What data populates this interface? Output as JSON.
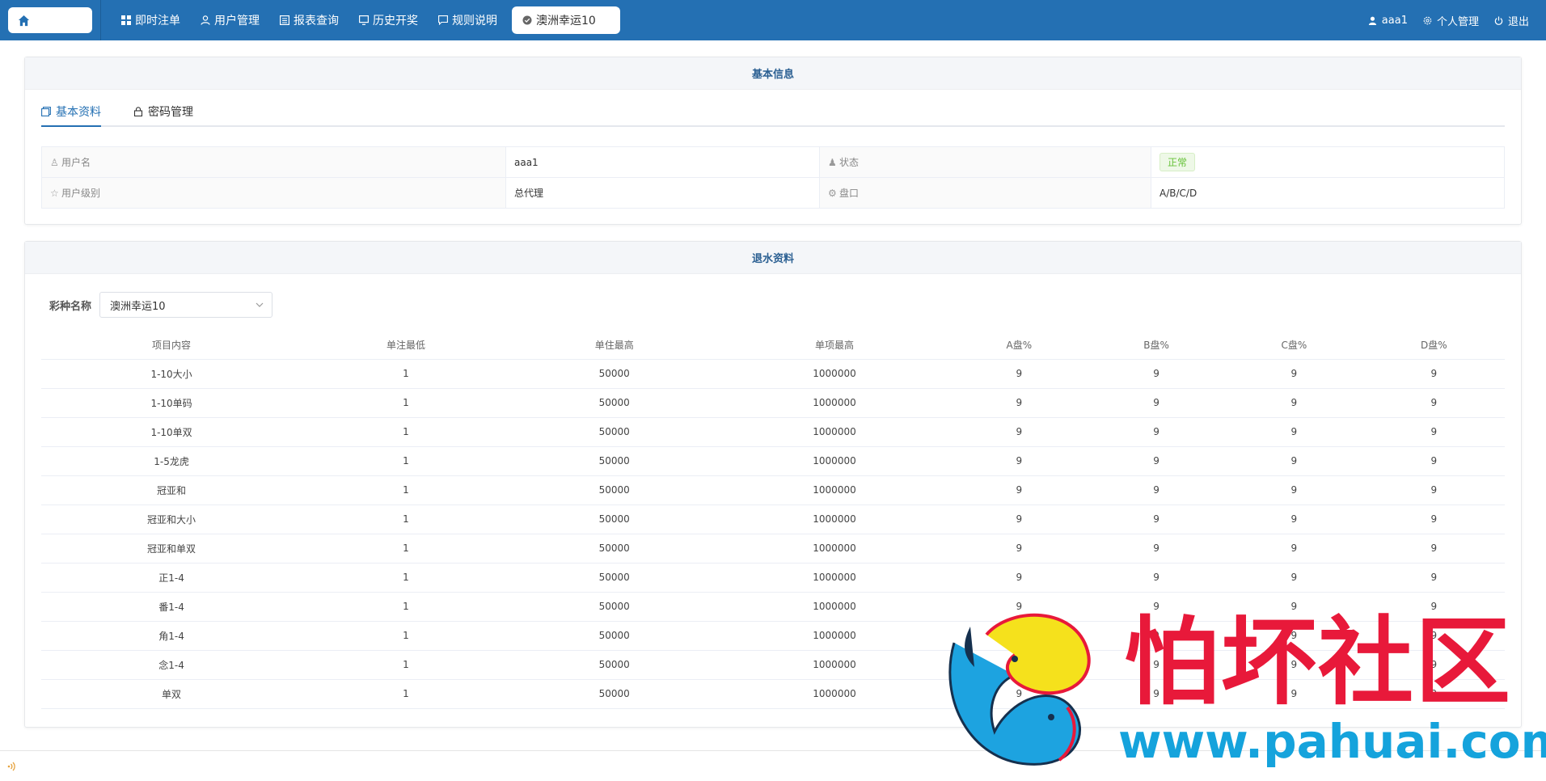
{
  "nav": {
    "items": [
      {
        "label": "即时注单",
        "icon": "grid-icon"
      },
      {
        "label": "用户管理",
        "icon": "user-icon"
      },
      {
        "label": "报表查询",
        "icon": "report-icon"
      },
      {
        "label": "历史开奖",
        "icon": "monitor-icon"
      },
      {
        "label": "规则说明",
        "icon": "message-icon"
      }
    ],
    "active_tab": "澳洲幸运10",
    "user": "aaa1",
    "profile": "个人管理",
    "logout": "退出"
  },
  "basic": {
    "title": "基本信息",
    "tabs": [
      "基本资料",
      "密码管理"
    ],
    "username_label": "用户名",
    "username": "aaa1",
    "status_label": "状态",
    "status": "正常",
    "level_label": "用户级别",
    "level": "总代理",
    "market_label": "盘口",
    "market": "A/B/C/D"
  },
  "rebate": {
    "title": "退水资料",
    "filter_label": "彩种名称",
    "filter_value": "澳洲幸运10",
    "columns": [
      "项目内容",
      "单注最低",
      "单住最高",
      "单项最高",
      "A盘%",
      "B盘%",
      "C盘%",
      "D盘%"
    ],
    "rows": [
      [
        "1-10大小",
        "1",
        "50000",
        "1000000",
        "9",
        "9",
        "9",
        "9"
      ],
      [
        "1-10单码",
        "1",
        "50000",
        "1000000",
        "9",
        "9",
        "9",
        "9"
      ],
      [
        "1-10单双",
        "1",
        "50000",
        "1000000",
        "9",
        "9",
        "9",
        "9"
      ],
      [
        "1-5龙虎",
        "1",
        "50000",
        "1000000",
        "9",
        "9",
        "9",
        "9"
      ],
      [
        "冠亚和",
        "1",
        "50000",
        "1000000",
        "9",
        "9",
        "9",
        "9"
      ],
      [
        "冠亚和大小",
        "1",
        "50000",
        "1000000",
        "9",
        "9",
        "9",
        "9"
      ],
      [
        "冠亚和单双",
        "1",
        "50000",
        "1000000",
        "9",
        "9",
        "9",
        "9"
      ],
      [
        "正1-4",
        "1",
        "50000",
        "1000000",
        "9",
        "9",
        "9",
        "9"
      ],
      [
        "番1-4",
        "1",
        "50000",
        "1000000",
        "9",
        "9",
        "9",
        "9"
      ],
      [
        "角1-4",
        "1",
        "50000",
        "1000000",
        "9",
        "9",
        "9",
        "9"
      ],
      [
        "念1-4",
        "1",
        "50000",
        "1000000",
        "9",
        "9",
        "9",
        "9"
      ],
      [
        "单双",
        "1",
        "50000",
        "1000000",
        "9",
        "9",
        "9",
        "9"
      ]
    ]
  },
  "watermark": {
    "text": "怕坏社区",
    "url": "www.pahuai.com"
  },
  "colors": {
    "brand": "#2470b3",
    "status_ok": "#67c23a"
  }
}
